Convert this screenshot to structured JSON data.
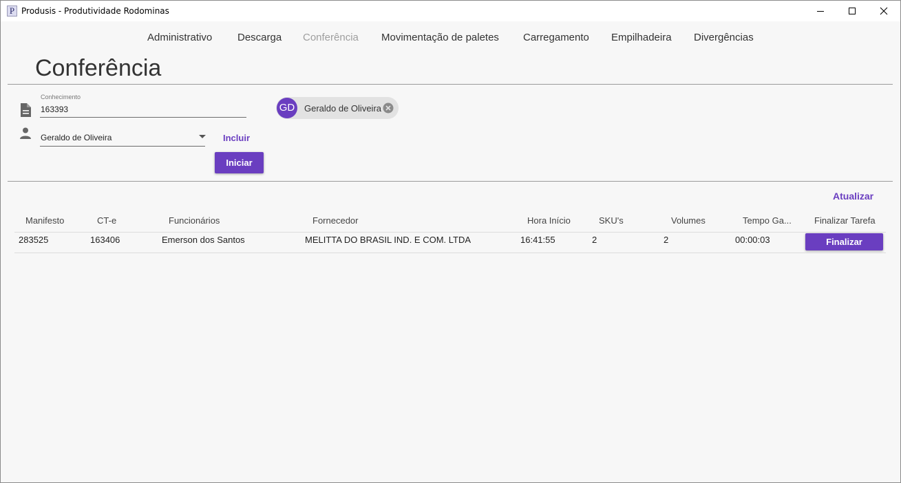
{
  "window": {
    "title": "Produsis - Produtividade Rodominas",
    "icon_letter": "P"
  },
  "nav": {
    "items": [
      {
        "label": "Administrativo"
      },
      {
        "label": "Descarga"
      },
      {
        "label": "Conferência",
        "active": true
      },
      {
        "label": "Movimentação de paletes"
      },
      {
        "label": "Carregamento"
      },
      {
        "label": "Empilhadeira"
      },
      {
        "label": "Divergências"
      }
    ]
  },
  "page": {
    "title": "Conferência"
  },
  "form": {
    "conhecimento_label": "Conhecimento",
    "conhecimento_value": "163393",
    "funcionario_value": "Geraldo de Oliveira",
    "incluir_label": "Incluir",
    "iniciar_label": "Iniciar"
  },
  "chip": {
    "initials": "GD",
    "name": "Geraldo de Oliveira"
  },
  "table": {
    "atualizar_label": "Atualizar",
    "headers": [
      "Manifesto",
      "CT-e",
      "Funcionários",
      "Fornecedor",
      "Hora Início",
      "SKU's",
      "Volumes",
      "Tempo Ga...",
      "Finalizar Tarefa"
    ],
    "rows": [
      {
        "manifesto": "283525",
        "cte": "163406",
        "funcionarios": "Emerson dos Santos",
        "fornecedor": "MELITTA DO BRASIL IND. E COM. LTDA",
        "hora_inicio": "16:41:55",
        "skus": "2",
        "volumes": "2",
        "tempo": "00:00:03",
        "finalizar_label": "Finalizar"
      }
    ]
  },
  "colors": {
    "accent": "#6a3ec0"
  }
}
